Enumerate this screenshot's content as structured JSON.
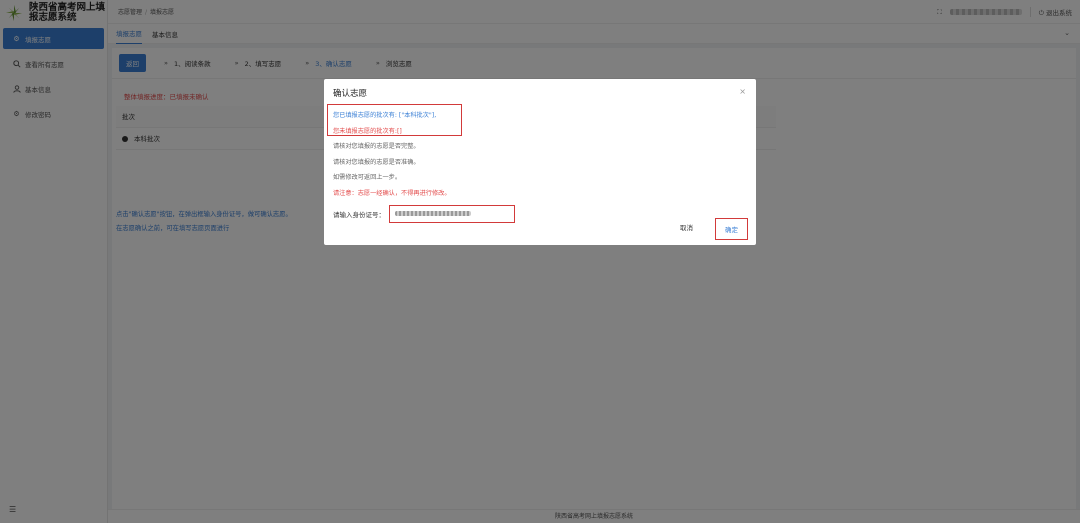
{
  "app": {
    "title": "陕西省高考网上填报志愿系统"
  },
  "sidebar": {
    "items": [
      {
        "label": "填报志愿",
        "icon": "gear-icon",
        "active": true
      },
      {
        "label": "查看所有志愿",
        "icon": "search-icon",
        "active": false
      },
      {
        "label": "基本信息",
        "icon": "user-icon",
        "active": false
      },
      {
        "label": "修改密码",
        "icon": "gear-icon",
        "active": false
      }
    ]
  },
  "header": {
    "breadcrumb": [
      "志愿管理",
      "填报志愿"
    ],
    "logout_label": "退出系统"
  },
  "tabs": [
    {
      "label": "填报志愿",
      "active": true
    },
    {
      "label": "基本信息",
      "active": false
    }
  ],
  "main": {
    "back_label": "返回",
    "steps": [
      {
        "label": "1、阅读条款",
        "current": false
      },
      {
        "label": "2、填写志愿",
        "current": false
      },
      {
        "label": "3、确认志愿",
        "current": true
      },
      {
        "label": "浏览志愿",
        "current": false
      }
    ],
    "progress_note": "整体填报进度：已填报未确认",
    "table_header": "批次",
    "table_row": "本科批次",
    "help_lines": [
      "点击\"确认志愿\"按钮，在弹出框输入身份证号，做可确认志愿。",
      "在志愿确认之前，可在填写志愿页面进行"
    ]
  },
  "footer": {
    "text": "陕西省高考网上填报志愿系统"
  },
  "dialog": {
    "title": "确认志愿",
    "close": "×",
    "lines": [
      {
        "text": "您已填报志愿的批次有: [\"本科批次\"],",
        "style": "blue"
      },
      {
        "text": "您未填报志愿的批次有:[]",
        "style": "red"
      },
      {
        "text": "请核对您填报的志愿是否完整。",
        "style": "gray"
      },
      {
        "text": "请核对您填报的志愿是否准确。",
        "style": "gray"
      },
      {
        "text": "如需修改可返回上一步。",
        "style": "gray"
      },
      {
        "text": "请注意：志愿一经确认，不得再进行修改。",
        "style": "red"
      }
    ],
    "id_label": "请输入身份证号：",
    "cancel_label": "取消",
    "ok_label": "确定"
  },
  "colors": {
    "accent": "#3a7fd5",
    "danger": "#e34b4b",
    "highlight": "#d23a3a"
  }
}
